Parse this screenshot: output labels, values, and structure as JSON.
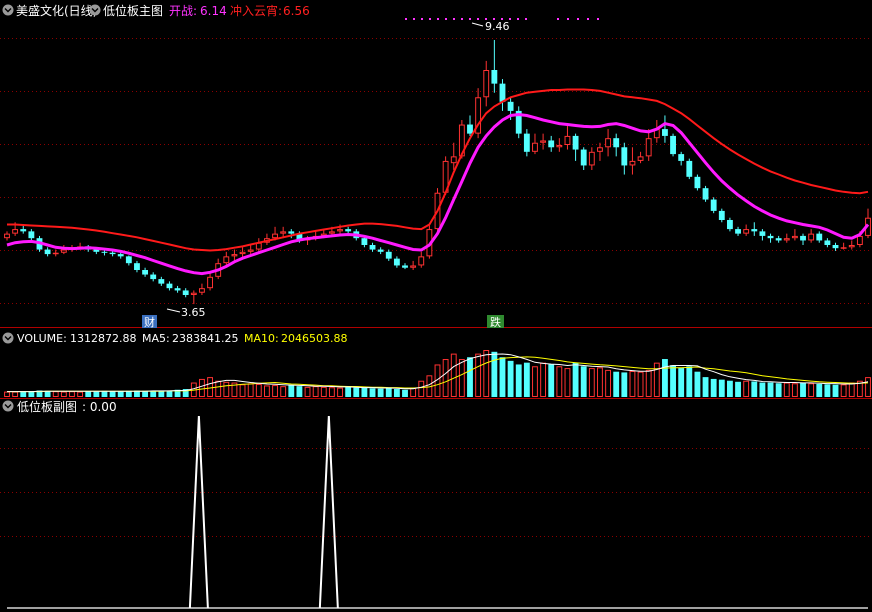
{
  "header": {
    "stock": "美盛文化(日线)",
    "indicator": "低位板主图",
    "kz_label": "开战:",
    "kz_value": "6.14",
    "cr_label": "冲入云宵:",
    "cr_value": "6.56"
  },
  "volume_header": {
    "vol_label": "VOLUME:",
    "vol_value": "1312872.88",
    "ma5_label": "MA5:",
    "ma5_value": "2383841.25",
    "ma10_label": "MA10:",
    "ma10_value": "2046503.88"
  },
  "sub_header": {
    "title": "低位板副图",
    "value": ": 0.00"
  },
  "annotations": {
    "high_label": "9.46",
    "low_label": "3.65",
    "cai": "财",
    "die": "跌"
  },
  "colors": {
    "up": "#ff3232",
    "down": "#54ffff",
    "cloud": "#ff1a1a",
    "kaizhan": "#ff1aff",
    "ma5": "#ffffff",
    "ma10": "#ffff00",
    "grid": "#8b0000",
    "spike": "#ffffff",
    "marker": "#ff33ff"
  },
  "chart_data": {
    "type": "candlestick",
    "title": "美盛文化(日线)",
    "price_ylim": [
      3.3,
      9.9
    ],
    "candles": [
      [
        5.1,
        5.2,
        5.25,
        5.05
      ],
      [
        5.2,
        5.3,
        5.45,
        5.15
      ],
      [
        5.3,
        5.25,
        5.4,
        5.2
      ],
      [
        5.25,
        5.1,
        5.3,
        5.05
      ],
      [
        5.1,
        4.85,
        5.15,
        4.8
      ],
      [
        4.85,
        4.75,
        4.9,
        4.7
      ],
      [
        4.75,
        4.78,
        4.85,
        4.7
      ],
      [
        4.78,
        4.85,
        4.95,
        4.75
      ],
      [
        4.85,
        4.9,
        4.95,
        4.8
      ],
      [
        4.9,
        4.92,
        5.0,
        4.85
      ],
      [
        4.92,
        4.85,
        4.95,
        4.8
      ],
      [
        4.85,
        4.8,
        4.9,
        4.75
      ],
      [
        4.8,
        4.78,
        4.85,
        4.72
      ],
      [
        4.78,
        4.75,
        4.82,
        4.7
      ],
      [
        4.75,
        4.7,
        4.8,
        4.65
      ],
      [
        4.7,
        4.55,
        4.72,
        4.5
      ],
      [
        4.55,
        4.4,
        4.6,
        4.35
      ],
      [
        4.4,
        4.3,
        4.45,
        4.25
      ],
      [
        4.3,
        4.2,
        4.35,
        4.15
      ],
      [
        4.2,
        4.1,
        4.25,
        4.05
      ],
      [
        4.1,
        4.0,
        4.15,
        3.95
      ],
      [
        4.0,
        3.95,
        4.05,
        3.9
      ],
      [
        3.95,
        3.85,
        4.0,
        3.8
      ],
      [
        3.85,
        3.9,
        3.95,
        3.65
      ],
      [
        3.9,
        4.0,
        4.1,
        3.85
      ],
      [
        4.0,
        4.25,
        4.35,
        3.95
      ],
      [
        4.25,
        4.55,
        4.65,
        4.2
      ],
      [
        4.55,
        4.7,
        4.8,
        4.5
      ],
      [
        4.7,
        4.75,
        4.85,
        4.6
      ],
      [
        4.75,
        4.8,
        4.9,
        4.65
      ],
      [
        4.8,
        4.85,
        4.95,
        4.75
      ],
      [
        4.85,
        5.0,
        5.1,
        4.8
      ],
      [
        5.0,
        5.1,
        5.2,
        4.95
      ],
      [
        5.1,
        5.2,
        5.35,
        5.05
      ],
      [
        5.2,
        5.25,
        5.35,
        5.1
      ],
      [
        5.25,
        5.2,
        5.3,
        5.1
      ],
      [
        5.2,
        5.05,
        5.25,
        5.0
      ],
      [
        5.05,
        5.1,
        5.15,
        4.95
      ],
      [
        5.1,
        5.15,
        5.25,
        5.05
      ],
      [
        5.15,
        5.2,
        5.3,
        5.1
      ],
      [
        5.2,
        5.25,
        5.35,
        5.15
      ],
      [
        5.25,
        5.3,
        5.4,
        5.2
      ],
      [
        5.3,
        5.25,
        5.35,
        5.2
      ],
      [
        5.25,
        5.1,
        5.3,
        5.05
      ],
      [
        5.1,
        4.95,
        5.15,
        4.9
      ],
      [
        4.95,
        4.85,
        5.0,
        4.8
      ],
      [
        4.85,
        4.8,
        4.9,
        4.75
      ],
      [
        4.8,
        4.65,
        4.85,
        4.6
      ],
      [
        4.65,
        4.5,
        4.7,
        4.45
      ],
      [
        4.5,
        4.45,
        4.55,
        4.42
      ],
      [
        4.45,
        4.5,
        4.6,
        4.4
      ],
      [
        4.5,
        4.7,
        4.8,
        4.45
      ],
      [
        4.7,
        5.3,
        5.4,
        4.65
      ],
      [
        5.3,
        6.1,
        6.2,
        5.25
      ],
      [
        6.1,
        6.8,
        6.9,
        6.05
      ],
      [
        6.75,
        6.9,
        7.2,
        6.6
      ],
      [
        6.9,
        7.6,
        7.7,
        6.85
      ],
      [
        7.6,
        7.4,
        7.8,
        7.35
      ],
      [
        7.4,
        8.2,
        8.4,
        7.3
      ],
      [
        8.2,
        8.8,
        9.0,
        8.0
      ],
      [
        8.8,
        8.5,
        9.46,
        8.3
      ],
      [
        8.5,
        8.1,
        8.6,
        7.9
      ],
      [
        8.1,
        7.9,
        8.2,
        7.7
      ],
      [
        7.9,
        7.4,
        8.0,
        7.3
      ],
      [
        7.4,
        7.0,
        7.5,
        6.9
      ],
      [
        7.0,
        7.2,
        7.4,
        6.95
      ],
      [
        7.2,
        7.25,
        7.4,
        7.05
      ],
      [
        7.25,
        7.1,
        7.35,
        7.0
      ],
      [
        7.1,
        7.15,
        7.3,
        7.0
      ],
      [
        7.15,
        7.35,
        7.6,
        7.05
      ],
      [
        7.35,
        7.05,
        7.4,
        6.8
      ],
      [
        7.05,
        6.7,
        7.1,
        6.6
      ],
      [
        6.7,
        7.0,
        7.1,
        6.6
      ],
      [
        7.0,
        7.1,
        7.2,
        6.8
      ],
      [
        7.1,
        7.3,
        7.5,
        6.9
      ],
      [
        7.3,
        7.1,
        7.4,
        6.9
      ],
      [
        7.1,
        6.7,
        7.2,
        6.5
      ],
      [
        6.7,
        6.8,
        7.1,
        6.5
      ],
      [
        6.8,
        6.9,
        7.0,
        6.75
      ],
      [
        6.9,
        7.3,
        7.5,
        6.8
      ],
      [
        7.3,
        7.5,
        7.7,
        7.2
      ],
      [
        7.5,
        7.35,
        7.8,
        7.2
      ],
      [
        7.35,
        6.95,
        7.4,
        6.9
      ],
      [
        6.95,
        6.8,
        7.0,
        6.7
      ],
      [
        6.8,
        6.45,
        6.85,
        6.4
      ],
      [
        6.45,
        6.2,
        6.5,
        6.15
      ],
      [
        6.2,
        5.95,
        6.25,
        5.9
      ],
      [
        5.95,
        5.7,
        6.0,
        5.65
      ],
      [
        5.7,
        5.5,
        5.75,
        5.45
      ],
      [
        5.5,
        5.3,
        5.55,
        5.25
      ],
      [
        5.3,
        5.2,
        5.35,
        5.15
      ],
      [
        5.2,
        5.3,
        5.4,
        5.15
      ],
      [
        5.3,
        5.25,
        5.45,
        5.15
      ],
      [
        5.25,
        5.15,
        5.3,
        5.05
      ],
      [
        5.15,
        5.1,
        5.2,
        5.0
      ],
      [
        5.1,
        5.05,
        5.15,
        5.0
      ],
      [
        5.05,
        5.1,
        5.2,
        5.0
      ],
      [
        5.1,
        5.15,
        5.3,
        5.05
      ],
      [
        5.15,
        5.05,
        5.2,
        4.95
      ],
      [
        5.05,
        5.2,
        5.3,
        5.0
      ],
      [
        5.2,
        5.05,
        5.25,
        5.0
      ],
      [
        5.05,
        4.95,
        5.1,
        4.9
      ],
      [
        4.95,
        4.88,
        5.0,
        4.82
      ],
      [
        4.88,
        4.9,
        5.0,
        4.85
      ],
      [
        4.9,
        4.95,
        5.05,
        4.85
      ],
      [
        4.95,
        5.15,
        5.25,
        4.9
      ],
      [
        5.15,
        5.55,
        5.75,
        5.1
      ]
    ],
    "cloud_line": [
      5.4,
      5.4,
      5.39,
      5.38,
      5.37,
      5.36,
      5.35,
      5.34,
      5.33,
      5.31,
      5.29,
      5.27,
      5.24,
      5.21,
      5.18,
      5.15,
      5.12,
      5.08,
      5.04,
      5.0,
      4.96,
      4.92,
      4.88,
      4.85,
      4.84,
      4.83,
      4.84,
      4.86,
      4.89,
      4.92,
      4.96,
      5.0,
      5.04,
      5.08,
      5.12,
      5.16,
      5.2,
      5.23,
      5.26,
      5.29,
      5.32,
      5.35,
      5.38,
      5.4,
      5.42,
      5.42,
      5.41,
      5.39,
      5.37,
      5.34,
      5.31,
      5.3,
      5.4,
      5.7,
      6.1,
      6.55,
      6.95,
      7.3,
      7.6,
      7.85,
      8.0,
      8.1,
      8.2,
      8.25,
      8.3,
      8.32,
      8.34,
      8.36,
      8.36,
      8.37,
      8.37,
      8.37,
      8.36,
      8.34,
      8.3,
      8.26,
      8.22,
      8.2,
      8.18,
      8.15,
      8.12,
      8.05,
      7.95,
      7.85,
      7.72,
      7.58,
      7.44,
      7.3,
      7.17,
      7.05,
      6.94,
      6.84,
      6.74,
      6.65,
      6.57,
      6.5,
      6.43,
      6.37,
      6.32,
      6.27,
      6.23,
      6.19,
      6.15,
      6.12,
      6.1,
      6.09,
      6.12
    ],
    "kaizhan_line": [
      4.95,
      5.0,
      5.02,
      5.03,
      5.0,
      4.95,
      4.9,
      4.88,
      4.87,
      4.88,
      4.89,
      4.88,
      4.86,
      4.84,
      4.81,
      4.77,
      4.72,
      4.67,
      4.61,
      4.55,
      4.49,
      4.43,
      4.38,
      4.34,
      4.32,
      4.35,
      4.4,
      4.48,
      4.58,
      4.66,
      4.72,
      4.78,
      4.84,
      4.9,
      4.96,
      5.02,
      5.06,
      5.09,
      5.11,
      5.13,
      5.15,
      5.17,
      5.18,
      5.17,
      5.14,
      5.1,
      5.05,
      5.0,
      4.95,
      4.9,
      4.85,
      4.84,
      4.95,
      5.2,
      5.55,
      5.95,
      6.35,
      6.75,
      7.1,
      7.35,
      7.55,
      7.7,
      7.8,
      7.82,
      7.8,
      7.75,
      7.7,
      7.66,
      7.62,
      7.6,
      7.58,
      7.56,
      7.55,
      7.56,
      7.6,
      7.62,
      7.58,
      7.52,
      7.46,
      7.44,
      7.5,
      7.62,
      7.58,
      7.42,
      7.2,
      6.98,
      6.76,
      6.55,
      6.36,
      6.2,
      6.05,
      5.92,
      5.8,
      5.7,
      5.61,
      5.54,
      5.48,
      5.44,
      5.4,
      5.37,
      5.34,
      5.28,
      5.2,
      5.12,
      5.1,
      5.18,
      5.4
    ],
    "volume": [
      0.15,
      0.15,
      0.14,
      0.16,
      0.18,
      0.17,
      0.16,
      0.15,
      0.16,
      0.15,
      0.16,
      0.15,
      0.17,
      0.16,
      0.16,
      0.17,
      0.18,
      0.17,
      0.16,
      0.17,
      0.18,
      0.2,
      0.22,
      0.4,
      0.5,
      0.55,
      0.45,
      0.42,
      0.4,
      0.35,
      0.38,
      0.36,
      0.32,
      0.33,
      0.3,
      0.32,
      0.3,
      0.28,
      0.3,
      0.28,
      0.27,
      0.26,
      0.28,
      0.26,
      0.25,
      0.24,
      0.23,
      0.25,
      0.22,
      0.2,
      0.25,
      0.45,
      0.6,
      0.9,
      1.05,
      1.2,
      1.05,
      1.1,
      1.2,
      1.3,
      1.25,
      1.1,
      1.0,
      0.9,
      0.95,
      0.85,
      0.95,
      0.9,
      0.85,
      0.8,
      0.95,
      0.85,
      0.8,
      0.82,
      0.75,
      0.7,
      0.68,
      0.72,
      0.7,
      0.75,
      0.95,
      1.05,
      0.88,
      0.8,
      0.85,
      0.7,
      0.55,
      0.5,
      0.48,
      0.45,
      0.42,
      0.45,
      0.43,
      0.4,
      0.4,
      0.38,
      0.4,
      0.38,
      0.4,
      0.38,
      0.36,
      0.35,
      0.34,
      0.35,
      0.4,
      0.45,
      0.55
    ],
    "vol_ma5": [
      0.15,
      0.15,
      0.15,
      0.15,
      0.16,
      0.16,
      0.16,
      0.16,
      0.16,
      0.16,
      0.16,
      0.16,
      0.16,
      0.16,
      0.16,
      0.16,
      0.16,
      0.16,
      0.17,
      0.17,
      0.17,
      0.18,
      0.18,
      0.23,
      0.3,
      0.37,
      0.42,
      0.46,
      0.46,
      0.43,
      0.4,
      0.38,
      0.36,
      0.35,
      0.34,
      0.33,
      0.32,
      0.31,
      0.3,
      0.3,
      0.29,
      0.28,
      0.28,
      0.27,
      0.26,
      0.26,
      0.25,
      0.25,
      0.24,
      0.23,
      0.23,
      0.27,
      0.34,
      0.48,
      0.65,
      0.84,
      0.96,
      1.06,
      1.12,
      1.17,
      1.18,
      1.19,
      1.17,
      1.11,
      1.04,
      0.96,
      0.93,
      0.91,
      0.9,
      0.87,
      0.89,
      0.87,
      0.85,
      0.84,
      0.83,
      0.78,
      0.75,
      0.73,
      0.71,
      0.71,
      0.76,
      0.83,
      0.87,
      0.87,
      0.87,
      0.86,
      0.77,
      0.7,
      0.62,
      0.56,
      0.52,
      0.48,
      0.46,
      0.43,
      0.42,
      0.41,
      0.4,
      0.4,
      0.39,
      0.39,
      0.38,
      0.37,
      0.37,
      0.36,
      0.36,
      0.38,
      0.42
    ],
    "vol_ma10": [
      0.15,
      0.15,
      0.15,
      0.15,
      0.15,
      0.16,
      0.16,
      0.16,
      0.16,
      0.16,
      0.16,
      0.16,
      0.16,
      0.16,
      0.16,
      0.16,
      0.16,
      0.16,
      0.16,
      0.16,
      0.17,
      0.17,
      0.17,
      0.19,
      0.22,
      0.25,
      0.28,
      0.31,
      0.33,
      0.35,
      0.36,
      0.38,
      0.39,
      0.4,
      0.38,
      0.36,
      0.35,
      0.34,
      0.33,
      0.31,
      0.31,
      0.3,
      0.29,
      0.29,
      0.28,
      0.27,
      0.27,
      0.26,
      0.26,
      0.25,
      0.25,
      0.26,
      0.28,
      0.34,
      0.42,
      0.52,
      0.62,
      0.73,
      0.84,
      0.94,
      1.02,
      1.07,
      1.09,
      1.1,
      1.11,
      1.1,
      1.07,
      1.04,
      1.01,
      0.97,
      0.95,
      0.93,
      0.91,
      0.89,
      0.88,
      0.86,
      0.84,
      0.82,
      0.8,
      0.78,
      0.78,
      0.8,
      0.81,
      0.81,
      0.82,
      0.83,
      0.8,
      0.78,
      0.75,
      0.72,
      0.7,
      0.67,
      0.63,
      0.59,
      0.56,
      0.53,
      0.5,
      0.48,
      0.46,
      0.44,
      0.42,
      0.41,
      0.4,
      0.39,
      0.38,
      0.38,
      0.39
    ],
    "sub_signal_ymax": 1,
    "sub_signal": [
      0,
      0,
      0,
      0,
      0,
      0,
      0,
      0,
      0,
      0,
      0,
      0,
      0,
      0,
      0,
      0,
      0,
      0,
      0,
      0,
      0,
      0,
      0,
      0,
      0,
      0,
      0,
      0,
      0,
      0,
      0,
      0,
      0,
      0,
      0,
      0,
      0,
      0,
      0,
      0,
      0,
      0,
      0,
      0,
      0,
      0,
      0,
      0,
      0,
      0,
      0,
      0,
      0,
      0,
      0,
      0,
      0,
      0,
      0,
      0,
      0,
      0,
      0,
      0,
      0,
      0,
      0,
      0,
      0,
      0,
      0,
      0,
      0,
      0,
      0,
      0,
      0,
      0,
      0,
      0,
      0,
      0,
      0,
      0,
      0,
      0,
      0,
      0,
      0,
      0,
      0,
      0,
      0,
      0,
      0,
      0,
      0,
      0,
      0,
      0,
      0,
      0,
      0,
      0,
      0,
      0,
      0
    ]
  }
}
